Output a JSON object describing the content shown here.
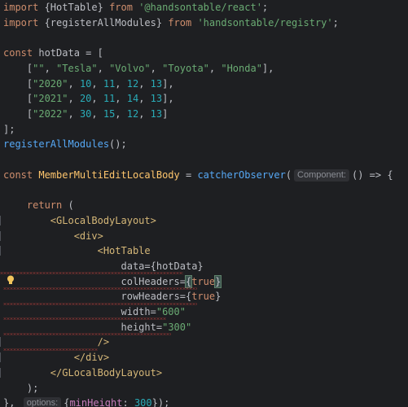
{
  "editor": {
    "lines": [
      [
        {
          "c": "kw",
          "t": "import"
        },
        {
          "c": "plain",
          "t": " {HotTable} "
        },
        {
          "c": "kw",
          "t": "from"
        },
        {
          "c": "plain",
          "t": " "
        },
        {
          "c": "str",
          "t": "'@handsontable/react'"
        },
        {
          "c": "plain",
          "t": ";"
        }
      ],
      [
        {
          "c": "kw",
          "t": "import"
        },
        {
          "c": "plain",
          "t": " {registerAllModules} "
        },
        {
          "c": "kw",
          "t": "from"
        },
        {
          "c": "plain",
          "t": " "
        },
        {
          "c": "str",
          "t": "'handsontable/registry'"
        },
        {
          "c": "plain",
          "t": ";"
        }
      ],
      [],
      [
        {
          "c": "kw",
          "t": "const"
        },
        {
          "c": "plain",
          "t": " hotData = ["
        }
      ],
      [
        {
          "c": "plain",
          "t": "    ["
        },
        {
          "c": "str",
          "t": "\"\""
        },
        {
          "c": "plain",
          "t": ", "
        },
        {
          "c": "str",
          "t": "\"Tesla\""
        },
        {
          "c": "plain",
          "t": ", "
        },
        {
          "c": "str",
          "t": "\"Volvo\""
        },
        {
          "c": "plain",
          "t": ", "
        },
        {
          "c": "str",
          "t": "\"Toyota\""
        },
        {
          "c": "plain",
          "t": ", "
        },
        {
          "c": "str",
          "t": "\"Honda\""
        },
        {
          "c": "plain",
          "t": "],"
        }
      ],
      [
        {
          "c": "plain",
          "t": "    ["
        },
        {
          "c": "str",
          "t": "\"2020\""
        },
        {
          "c": "plain",
          "t": ", "
        },
        {
          "c": "num",
          "t": "10"
        },
        {
          "c": "plain",
          "t": ", "
        },
        {
          "c": "num",
          "t": "11"
        },
        {
          "c": "plain",
          "t": ", "
        },
        {
          "c": "num",
          "t": "12"
        },
        {
          "c": "plain",
          "t": ", "
        },
        {
          "c": "num",
          "t": "13"
        },
        {
          "c": "plain",
          "t": "],"
        }
      ],
      [
        {
          "c": "plain",
          "t": "    ["
        },
        {
          "c": "str",
          "t": "\"2021\""
        },
        {
          "c": "plain",
          "t": ", "
        },
        {
          "c": "num",
          "t": "20"
        },
        {
          "c": "plain",
          "t": ", "
        },
        {
          "c": "num",
          "t": "11"
        },
        {
          "c": "plain",
          "t": ", "
        },
        {
          "c": "num",
          "t": "14"
        },
        {
          "c": "plain",
          "t": ", "
        },
        {
          "c": "num",
          "t": "13"
        },
        {
          "c": "plain",
          "t": "],"
        }
      ],
      [
        {
          "c": "plain",
          "t": "    ["
        },
        {
          "c": "str",
          "t": "\"2022\""
        },
        {
          "c": "plain",
          "t": ", "
        },
        {
          "c": "num",
          "t": "30"
        },
        {
          "c": "plain",
          "t": ", "
        },
        {
          "c": "num",
          "t": "15"
        },
        {
          "c": "plain",
          "t": ", "
        },
        {
          "c": "num",
          "t": "12"
        },
        {
          "c": "plain",
          "t": ", "
        },
        {
          "c": "num",
          "t": "13"
        },
        {
          "c": "plain",
          "t": "]"
        }
      ],
      [
        {
          "c": "plain",
          "t": "];"
        }
      ],
      [
        {
          "c": "fn",
          "t": "registerAllModules"
        },
        {
          "c": "plain",
          "t": "();"
        }
      ],
      [],
      [
        {
          "c": "kw",
          "t": "const"
        },
        {
          "c": "plain",
          "t": " "
        },
        {
          "c": "fn2",
          "t": "MemberMultiEditLocalBody"
        },
        {
          "c": "plain",
          "t": " = "
        },
        {
          "c": "fn",
          "t": "catcherObserver"
        },
        {
          "c": "plain",
          "t": "("
        },
        {
          "c": "hint",
          "t": "Component:"
        },
        {
          "c": "plain",
          "t": "() => {"
        }
      ],
      [],
      [
        {
          "c": "plain",
          "t": "    "
        },
        {
          "c": "kw",
          "t": "return"
        },
        {
          "c": "plain",
          "t": " ("
        }
      ],
      [
        {
          "c": "plain",
          "t": "        "
        },
        {
          "c": "tag",
          "t": "<GLocalBodyLayout>"
        }
      ],
      [
        {
          "c": "plain",
          "t": "            "
        },
        {
          "c": "tag",
          "t": "<div>"
        }
      ],
      [
        {
          "c": "plain",
          "t": "                "
        },
        {
          "c": "tag",
          "t": "<HotTable"
        }
      ],
      [
        {
          "c": "plain",
          "t": "                    "
        },
        {
          "c": "attr",
          "t": "data"
        },
        {
          "c": "plain",
          "t": "={hotData}"
        }
      ],
      [
        {
          "c": "plain",
          "t": "                    "
        },
        {
          "c": "attr",
          "t": "colHeaders"
        },
        {
          "c": "plain",
          "t": "="
        },
        {
          "c": "brace",
          "t": "{"
        },
        {
          "c": "kw",
          "t": "true"
        },
        {
          "c": "brace",
          "t": "}"
        }
      ],
      [
        {
          "c": "plain",
          "t": "                    "
        },
        {
          "c": "attr",
          "t": "rowHeaders"
        },
        {
          "c": "plain",
          "t": "={"
        },
        {
          "c": "kw",
          "t": "true"
        },
        {
          "c": "plain",
          "t": "}"
        }
      ],
      [
        {
          "c": "plain",
          "t": "                    "
        },
        {
          "c": "attr",
          "t": "width"
        },
        {
          "c": "plain",
          "t": "="
        },
        {
          "c": "str",
          "t": "\"600\""
        }
      ],
      [
        {
          "c": "plain",
          "t": "                    "
        },
        {
          "c": "attr",
          "t": "height"
        },
        {
          "c": "plain",
          "t": "="
        },
        {
          "c": "str",
          "t": "\"300\""
        }
      ],
      [
        {
          "c": "plain",
          "t": "                "
        },
        {
          "c": "tag",
          "t": "/>"
        }
      ],
      [
        {
          "c": "plain",
          "t": "            "
        },
        {
          "c": "tag",
          "t": "</div>"
        }
      ],
      [
        {
          "c": "plain",
          "t": "        "
        },
        {
          "c": "tag",
          "t": "</GLocalBodyLayout>"
        }
      ],
      [
        {
          "c": "plain",
          "t": "    );"
        }
      ],
      [
        {
          "c": "plain",
          "t": "}, "
        },
        {
          "c": "hint",
          "t": "options:"
        },
        {
          "c": "plain",
          "t": "{"
        },
        {
          "c": "prop",
          "t": "minHeight"
        },
        {
          "c": "plain",
          "t": ": "
        },
        {
          "c": "num",
          "t": "300"
        },
        {
          "c": "plain",
          "t": "});"
        }
      ]
    ]
  },
  "colors": {
    "background": "#1e1f22",
    "keyword": "#cf8e6d",
    "string": "#6aab73",
    "number": "#2aacb8",
    "tag": "#d5b778",
    "function": "#56a8f5",
    "error_underline": "#bc3f3c",
    "bulb": "#f2c55c"
  },
  "icons": {
    "intention": "lightbulb-icon"
  }
}
